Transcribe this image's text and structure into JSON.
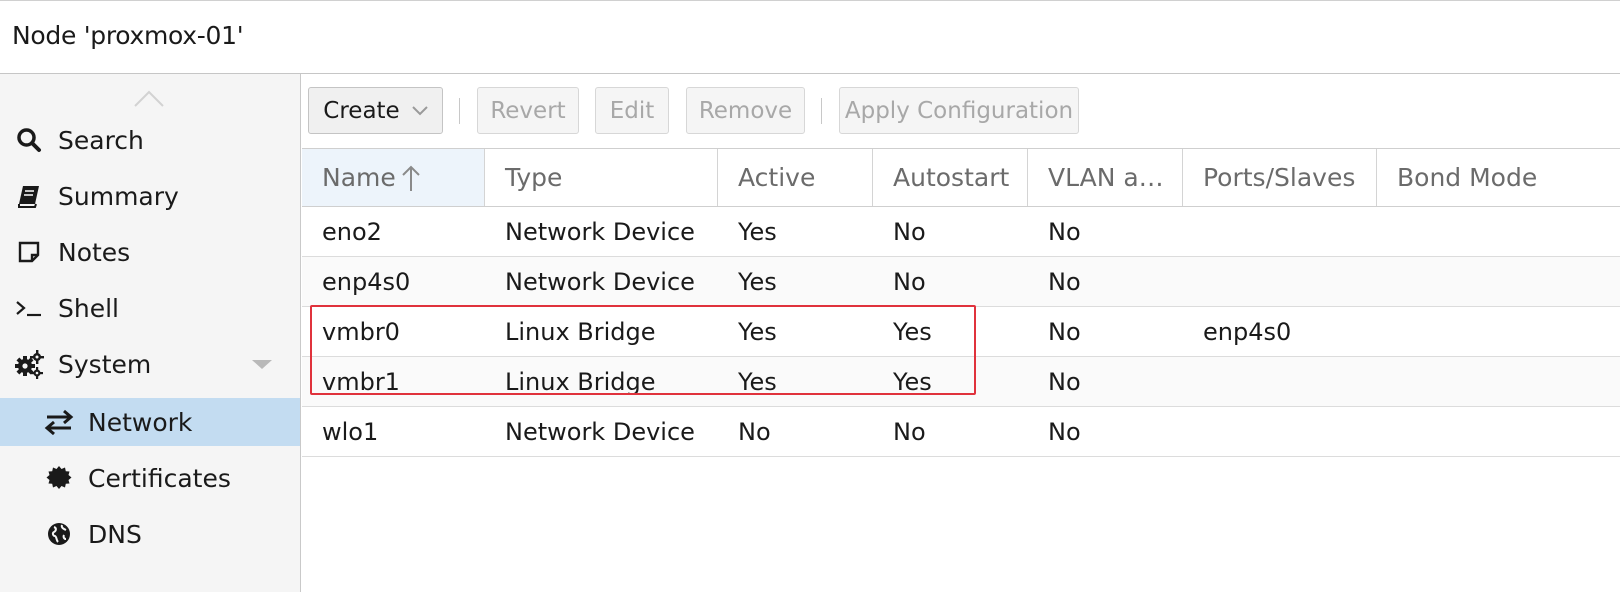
{
  "header": {
    "title": "Node 'proxmox-01'"
  },
  "sidebar": {
    "items": [
      {
        "label": "Search",
        "icon": "search-icon"
      },
      {
        "label": "Summary",
        "icon": "book-icon"
      },
      {
        "label": "Notes",
        "icon": "note-icon"
      },
      {
        "label": "Shell",
        "icon": "terminal-icon"
      },
      {
        "label": "System",
        "icon": "gears-icon"
      },
      {
        "label": "Network",
        "icon": "exchange-icon",
        "selected": true
      },
      {
        "label": "Certificates",
        "icon": "certificate-icon"
      },
      {
        "label": "DNS",
        "icon": "globe-icon"
      }
    ]
  },
  "toolbar": {
    "create_label": "Create",
    "revert_label": "Revert",
    "edit_label": "Edit",
    "remove_label": "Remove",
    "apply_label": "Apply Configuration"
  },
  "grid": {
    "columns": [
      "Name",
      "Type",
      "Active",
      "Autostart",
      "VLAN a…",
      "Ports/Slaves",
      "Bond Mode"
    ],
    "sort_column": "Name",
    "sort_direction": "ascending",
    "rows": [
      [
        "eno2",
        "Network Device",
        "Yes",
        "No",
        "No",
        "",
        ""
      ],
      [
        "enp4s0",
        "Network Device",
        "Yes",
        "No",
        "No",
        "",
        ""
      ],
      [
        "vmbr0",
        "Linux Bridge",
        "Yes",
        "Yes",
        "No",
        "enp4s0",
        ""
      ],
      [
        "vmbr1",
        "Linux Bridge",
        "Yes",
        "Yes",
        "No",
        "",
        ""
      ],
      [
        "wlo1",
        "Network Device",
        "No",
        "No",
        "No",
        "",
        ""
      ]
    ]
  },
  "colors": {
    "selected_nav": "#c3dcf1",
    "sorted_header": "#edf4fb",
    "highlight_box": "#e0323c"
  }
}
